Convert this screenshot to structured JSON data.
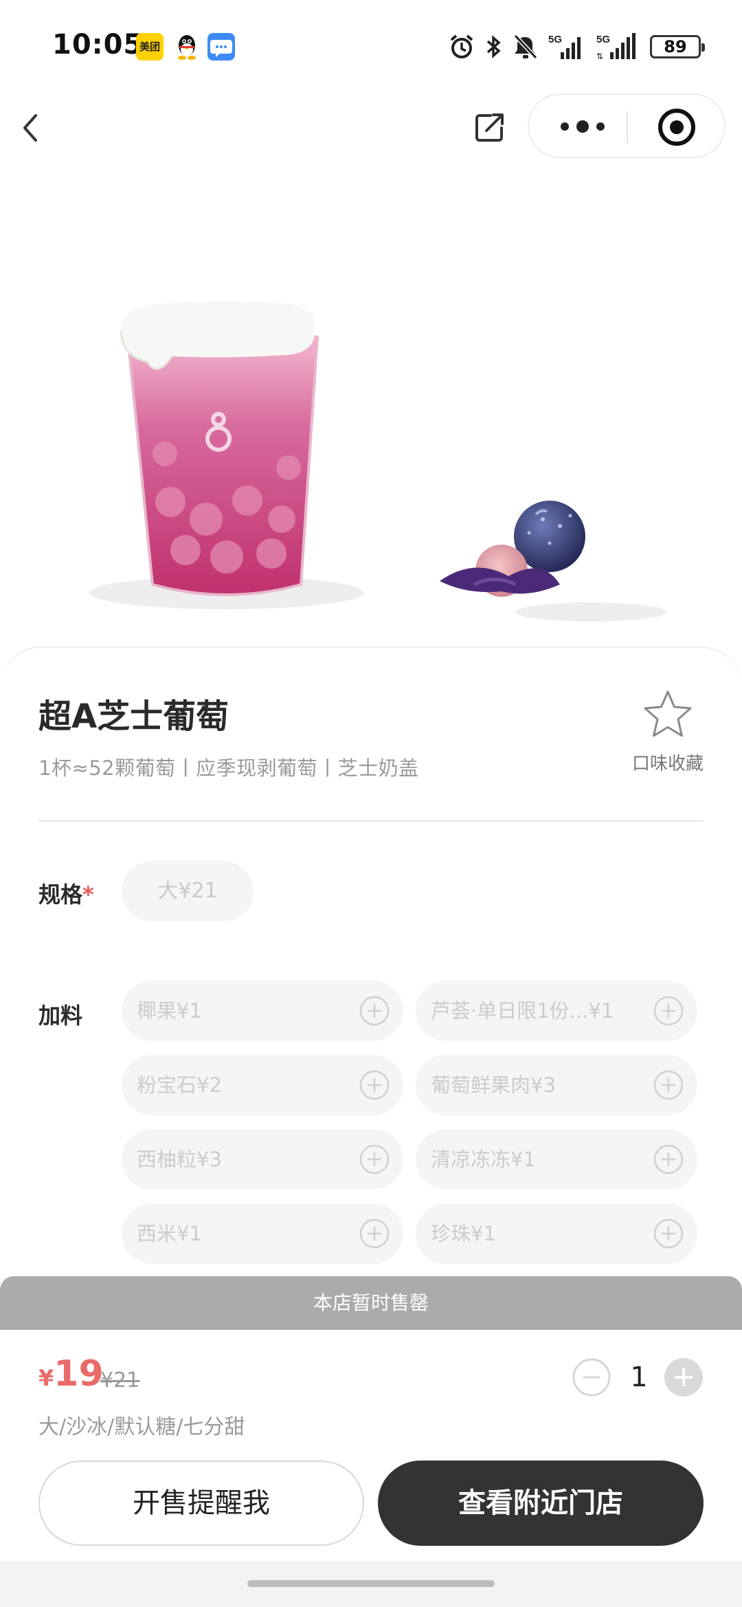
{
  "status_bar": {
    "time": "10:05",
    "meituan_badge": "美团",
    "battery": "89",
    "network_label": "5G"
  },
  "nav": {
    "back_icon": "chevron-left-icon",
    "share_icon": "share-icon",
    "more_icon": "more-dots-icon",
    "close_icon": "target-close-icon"
  },
  "product": {
    "name": "超A芝士葡萄",
    "description": "1杯≈52颗葡萄丨应季现剥葡萄丨芝士奶盖",
    "favorite_label": "口味收藏"
  },
  "spec": {
    "label": "规格",
    "required_mark": "*",
    "options": [
      "大¥21"
    ]
  },
  "toppings": {
    "label": "加料",
    "items": [
      "椰果¥1",
      "芦荟·单日限1份...¥1",
      "粉宝石¥2",
      "葡萄鲜果肉¥3",
      "西柚粒¥3",
      "清凉冻冻¥1",
      "西米¥1",
      "珍珠¥1"
    ]
  },
  "soldout_notice": "本店暂时售罄",
  "cart": {
    "currency": "¥",
    "price": "19",
    "original_price": "¥21",
    "selected_options": "大/沙冰/默认糖/七分甜",
    "quantity": "1"
  },
  "actions": {
    "remind_label": "开售提醒我",
    "nearby_label": "查看附近门店"
  },
  "colors": {
    "accent_price": "#ea6a6a",
    "primary_button": "#333333",
    "soldout_bar": "#ababab"
  }
}
